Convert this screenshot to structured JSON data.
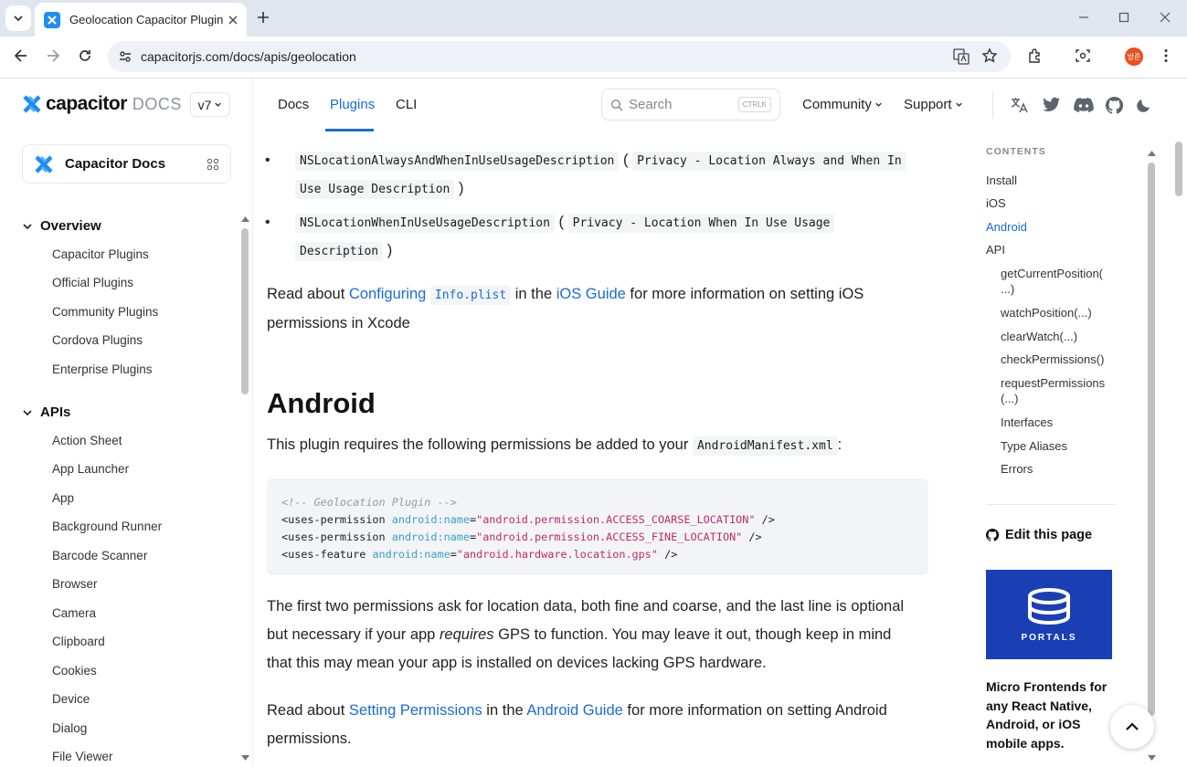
{
  "browser": {
    "tab_title": "Geolocation Capacitor Plugin API",
    "url": "capacitorjs.com/docs/apis/geolocation",
    "profile_initials": "방준"
  },
  "header": {
    "brand": "capacitor",
    "docs_label": "DOCS",
    "version": "v7",
    "nav": [
      "Docs",
      "Plugins",
      "CLI"
    ],
    "search_placeholder": "Search",
    "search_shortcut": "CTRLK",
    "community": "Community",
    "support": "Support"
  },
  "sidebar": {
    "card_title": "Capacitor Docs",
    "overview": {
      "title": "Overview",
      "items": [
        "Capacitor Plugins",
        "Official Plugins",
        "Community Plugins",
        "Cordova Plugins",
        "Enterprise Plugins"
      ]
    },
    "apis": {
      "title": "APIs",
      "items": [
        "Action Sheet",
        "App Launcher",
        "App",
        "Background Runner",
        "Barcode Scanner",
        "Browser",
        "Camera",
        "Clipboard",
        "Cookies",
        "Device",
        "Dialog",
        "File Viewer"
      ]
    }
  },
  "main": {
    "bullet1_code": "NSLocationAlwaysAndWhenInUseUsageDescription",
    "bullet1_paren_open": "(",
    "bullet1_desc_a": "Privacy - Location Always and When In",
    "bullet1_desc_b": "Use Usage Description",
    "bullet1_paren_close": ")",
    "bullet2_code": "NSLocationWhenInUseUsageDescription",
    "bullet2_paren_open": "(",
    "bullet2_desc_a": "Privacy - Location When In Use Usage",
    "bullet2_desc_b": "Description",
    "bullet2_paren_close": ")",
    "read1_a": "Read about ",
    "read1_link1": "Configuring",
    "read1_code": "Info.plist",
    "read1_b": " in the ",
    "read1_link2": "iOS Guide",
    "read1_c": " for more information on setting iOS",
    "read1_d": "permissions in Xcode",
    "heading": "Android",
    "intro": "This plugin requires the following permissions be added to your ",
    "intro_code": "AndroidManifest.xml",
    "intro_end": ":",
    "code_comment": "<!-- Geolocation Plugin -->",
    "code_lines": [
      {
        "tag": "<uses-permission",
        "attr": "android:name",
        "val": "\"android.permission.ACCESS_COARSE_LOCATION\"",
        "end": " />"
      },
      {
        "tag": "<uses-permission",
        "attr": "android:name",
        "val": "\"android.permission.ACCESS_FINE_LOCATION\"",
        "end": " />"
      },
      {
        "tag": "<uses-feature",
        "attr": "android:name",
        "val": "\"android.hardware.location.gps\"",
        "end": " />"
      }
    ],
    "para_a": "The first two permissions ask for location data, both fine and coarse, and the last line is optional",
    "para_b1": "but necessary if your app ",
    "para_b_em": "requires",
    "para_b2": " GPS to function. You may leave it out, though keep in mind",
    "para_c": "that this may mean your app is installed on devices lacking GPS hardware.",
    "read2_a": "Read about ",
    "read2_link1": "Setting Permissions",
    "read2_b": " in the ",
    "read2_link2": "Android Guide",
    "read2_c": " for more information on setting Android",
    "read2_d": "permissions."
  },
  "toc": {
    "heading": "CONTENTS",
    "items": [
      "Install",
      "iOS",
      "Android",
      "API"
    ],
    "sub": [
      "getCurrentPosition(",
      "...)",
      "watchPosition(...)",
      "clearWatch(...)",
      "checkPermissions()",
      "requestPermissions",
      "(...)",
      "Interfaces",
      "Type Aliases",
      "Errors"
    ],
    "edit": "Edit this page",
    "portals": "PORTALS",
    "promo": "Micro Frontends for any React Native, Android, or iOS mobile apps."
  }
}
